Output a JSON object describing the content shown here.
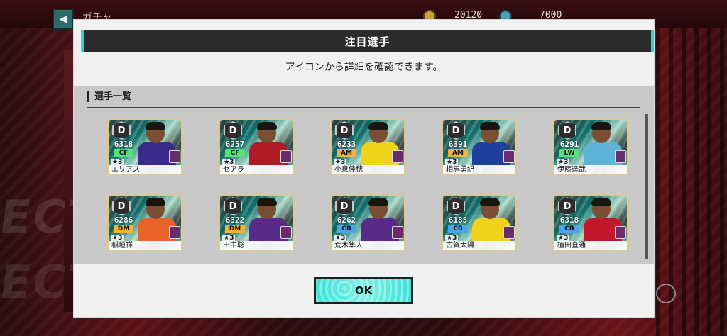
{
  "background": {
    "title": "ガチャ",
    "coins": "20120",
    "gems": "7000",
    "word1": "ECT",
    "word2": "ECT"
  },
  "modal": {
    "title": "注目選手",
    "subtitle": "アイコンから詳細を確認できます。",
    "section_label": "選手一覧",
    "ok_label": "OK",
    "players": [
      {
        "name": "エリアス",
        "rating": "6318",
        "position": "CF",
        "grade": "D",
        "stars": "★3",
        "pos_color": "#59e07a",
        "kit_color": "#3a2a8a"
      },
      {
        "name": "セアラ",
        "rating": "6257",
        "position": "CF",
        "grade": "D",
        "stars": "★3",
        "pos_color": "#59e07a",
        "kit_color": "#b01a24"
      },
      {
        "name": "小泉佳穂",
        "rating": "6233",
        "position": "AM",
        "grade": "D",
        "stars": "★3",
        "pos_color": "#f3b23a",
        "kit_color": "#f0d21a"
      },
      {
        "name": "相馬勇紀",
        "rating": "6391",
        "position": "AM",
        "grade": "D",
        "stars": "★3",
        "pos_color": "#f3b23a",
        "kit_color": "#1e3f9a"
      },
      {
        "name": "伊藤達哉",
        "rating": "6291",
        "position": "LW",
        "grade": "D",
        "stars": "★3",
        "pos_color": "#59e07a",
        "kit_color": "#5fb2d8"
      },
      {
        "name": "稲垣祥",
        "rating": "6286",
        "position": "DM",
        "grade": "D",
        "stars": "★3",
        "pos_color": "#f3b23a",
        "kit_color": "#e8622a"
      },
      {
        "name": "田中聡",
        "rating": "6322",
        "position": "DM",
        "grade": "D",
        "stars": "★3",
        "pos_color": "#f3b23a",
        "kit_color": "#5a2a8a"
      },
      {
        "name": "荒木隼人",
        "rating": "6262",
        "position": "CB",
        "grade": "D",
        "stars": "★3",
        "pos_color": "#4aa6e8",
        "kit_color": "#5a2a8a"
      },
      {
        "name": "古賀太陽",
        "rating": "6185",
        "position": "CB",
        "grade": "D",
        "stars": "★3",
        "pos_color": "#4aa6e8",
        "kit_color": "#f0d21a"
      },
      {
        "name": "植田直通",
        "rating": "6318",
        "position": "CB",
        "grade": "D",
        "stars": "★3",
        "pos_color": "#4aa6e8",
        "kit_color": "#c0182a"
      }
    ]
  }
}
